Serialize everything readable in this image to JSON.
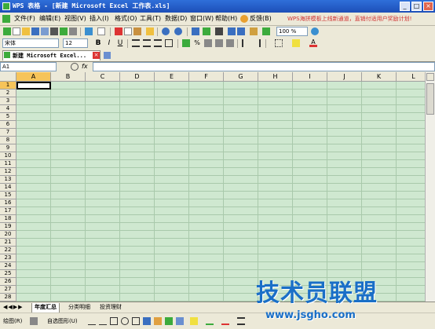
{
  "window": {
    "title": "WPS 表格 - [新建 Microsoft Excel 工作表.xls]",
    "btn_minimize": "_",
    "btn_maximize": "□",
    "btn_close": "×"
  },
  "menu": {
    "items": [
      "文件(F)",
      "编辑(E)",
      "视图(V)",
      "插入(I)",
      "格式(O)",
      "工具(T)",
      "数据(D)",
      "窗口(W)",
      "帮助(H)",
      "反馈(B)"
    ],
    "promo": "WPS海拼模板上线新通道，直销付适用户奖励计划!"
  },
  "toolbar_std": {
    "zoom": "100 %"
  },
  "toolbar_fmt": {
    "font_name": "宋体",
    "font_size": "12"
  },
  "doc_tab": {
    "label": "新建 Microsoft Excel..."
  },
  "formula_bar": {
    "cell_ref": "A1",
    "fx_label": "fx"
  },
  "sheet": {
    "columns": [
      "A",
      "B",
      "C",
      "D",
      "E",
      "F",
      "G",
      "H",
      "I",
      "J",
      "K",
      "L"
    ],
    "rows": [
      "1",
      "2",
      "3",
      "4",
      "5",
      "6",
      "7",
      "8",
      "9",
      "10",
      "11",
      "12",
      "13",
      "14",
      "15",
      "16",
      "17",
      "18",
      "19",
      "20",
      "21",
      "22",
      "23",
      "24",
      "25",
      "26",
      "27",
      "28"
    ],
    "active_cell": "A1"
  },
  "sheet_tabs": [
    "年度汇总",
    "分类明细",
    "投资理财"
  ],
  "drawing_bar": {
    "draw_label": "绘图(R)",
    "autoshape_label": "自选图形(U)"
  },
  "watermark": {
    "title": "技术员联盟",
    "url": "www.jsgho.com"
  },
  "colors": {
    "titlebar": "#1d4fb8",
    "grid_bg": "#cfe8d0",
    "selected_header": "#f6c45a",
    "watermark": "#1a6fc7"
  }
}
